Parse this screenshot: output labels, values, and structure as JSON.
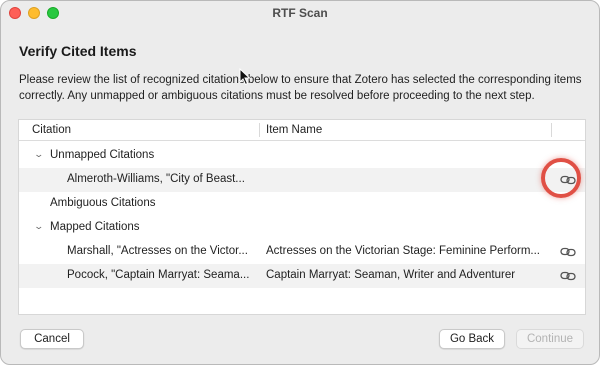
{
  "window": {
    "title": "RTF Scan"
  },
  "page": {
    "heading": "Verify Cited Items",
    "description": "Please review the list of recognized citations below to ensure that Zotero has selected the corresponding items correctly. Any unmapped or ambiguous citations must be resolved before proceeding to the next step."
  },
  "table": {
    "columns": {
      "citation": "Citation",
      "item_name": "Item Name"
    },
    "groups": {
      "unmapped": "Unmapped Citations",
      "ambiguous": "Ambiguous Citations",
      "mapped": "Mapped Citations"
    },
    "rows": [
      {
        "citation": "Almeroth-Williams, \"City of Beast...",
        "item": ""
      },
      {
        "citation": "Marshall, \"Actresses on the Victor...",
        "item": "Actresses on the Victorian Stage: Feminine Perform..."
      },
      {
        "citation": "Pocock, \"Captain Marryat: Seama...",
        "item": "Captain Marryat: Seaman, Writer and Adventurer"
      }
    ]
  },
  "buttons": {
    "cancel": "Cancel",
    "go_back": "Go Back",
    "continue": "Continue"
  },
  "colors": {
    "highlight_ring": "#e05045",
    "stripe": "#f2f2f2"
  },
  "icons": {
    "row_action": "link-icon"
  }
}
